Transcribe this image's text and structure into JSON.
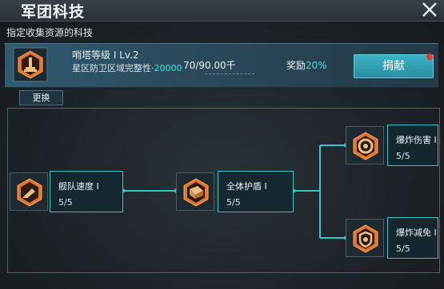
{
  "window": {
    "title": "军团科技"
  },
  "subtitle": "指定收集资源的科技",
  "task": {
    "name": "哨塔等级 I Lv.2",
    "desc_prefix": "星区防卫区域完整性·",
    "desc_value": "20000",
    "progress": "70/90.00千",
    "reward_prefix": "奖励",
    "reward_pct": "20%",
    "donate_label": "捐献"
  },
  "switch_label": "更换",
  "nodes": [
    {
      "name": "舰队速度 I",
      "level": "5/5",
      "icon": "fleet-speed-icon"
    },
    {
      "name": "全体护盾 I",
      "level": "5/5",
      "icon": "shield-icon"
    },
    {
      "name": "爆炸伤害 I",
      "level": "5/5",
      "icon": "explosion-damage-icon"
    },
    {
      "name": "爆炸减免 I",
      "level": "5/5",
      "icon": "explosion-reduction-icon"
    }
  ],
  "colors": {
    "accent": "#39e6e0",
    "link": "#33c5c8",
    "hex_orange": "#e8742a",
    "frame_red": "#e3281e",
    "button": "#2a8ea0"
  }
}
